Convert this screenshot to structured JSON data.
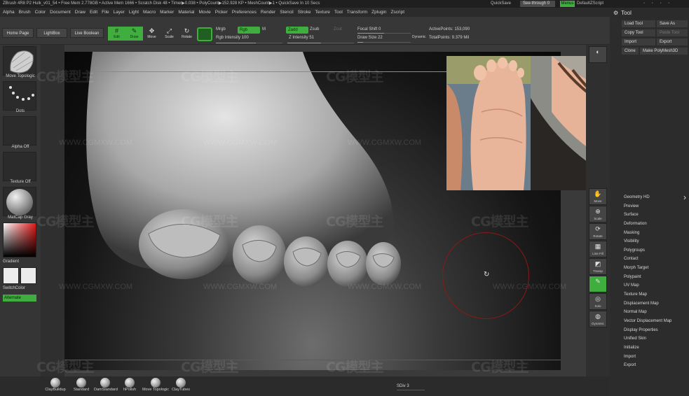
{
  "titlebar": {
    "info": "ZBrush 4R8 P2    Hulk_v01_54    • Free Mem 2.778GB • Active Mem 1666 • Scratch Disk 48 • Timer▶0.038 • PolyCount▶152.928 KP • MeshCount▶1 • QuickSave In 10 Secs",
    "quicksave": "QuickSave",
    "see_through": "See-through  0",
    "menus": "Menus",
    "script": "DefaultZScript",
    "window_icons": "◦ ◦ ◦ ◦"
  },
  "menubar": [
    "Alpha",
    "Brush",
    "Color",
    "Document",
    "Draw",
    "Edit",
    "File",
    "Layer",
    "Light",
    "Macro",
    "Marker",
    "Material",
    "Movie",
    "Picker",
    "Preferences",
    "Render",
    "Stencil",
    "Stroke",
    "Texture",
    "Tool",
    "Transform",
    "Zplugin",
    "Zscript"
  ],
  "toolhead": {
    "gear": "⚙",
    "title": "Tool"
  },
  "shelf": {
    "home_page": "Home Page",
    "lightbox": "LightBox",
    "live_boolean": "Live Boolean",
    "edit": "Edit",
    "draw": "Draw",
    "move": "Move",
    "scale": "Scale",
    "rotate": "Rotate",
    "mrgb": "Mrgb",
    "rgb": "Rgb",
    "m": "M",
    "zadd": "Zadd",
    "zsub": "Zsub",
    "zcut": "Zcut",
    "rgb_intensity": "Rgb Intensity 100",
    "z_intensity": "Z Intensity 51",
    "focal_shift": "Focal Shift 0",
    "draw_size": "Draw Size 22",
    "dynamic": "Dynamic",
    "active_points": "ActivePoints: 153,090",
    "total_points": "TotalPoints: 9.379 Mil"
  },
  "lefttray": {
    "brush": "Move Topologic",
    "stroke": "Dots",
    "alpha": "Alpha Off",
    "texture": "Texture Off",
    "material": "MatCap Gray",
    "gradient": "Gradient",
    "switch_color": "SwitchColor",
    "alternate": "Alternate"
  },
  "watermark": {
    "brand": "CG模型主",
    "url": "WWW.CGMXW.COM"
  },
  "toolpanel": {
    "load_tool": "Load Tool",
    "save_as": "Save As",
    "copy_tool": "Copy Tool",
    "paste_tool": "Paste Tool",
    "import": "Import",
    "export": "Export",
    "clone": "Clone",
    "make_polymesh": "Make PolyMesh3D",
    "items": [
      "Geometry HD",
      "Preview",
      "Surface",
      "Deformation",
      "Masking",
      "Visibility",
      "Polygroups",
      "Contact",
      "Morph Target",
      "Polypaint",
      "UV Map",
      "Texture Map",
      "Displacement Map",
      "Normal Map",
      "Vector Displacement Map",
      "Display Properties",
      "Unified Skin",
      "Initialize",
      "Import",
      "Export"
    ]
  },
  "righticons": [
    "Move",
    "Scale",
    "Rotate",
    "Line Fill",
    "Transp",
    "Solo",
    "Dynamic"
  ],
  "bottom": {
    "brushes": [
      "ClayBuildup",
      "Standard",
      "DamStandard",
      "hPolish",
      "Move Topologic",
      "ClayTubes"
    ],
    "sdiv": "SDiv 3"
  }
}
